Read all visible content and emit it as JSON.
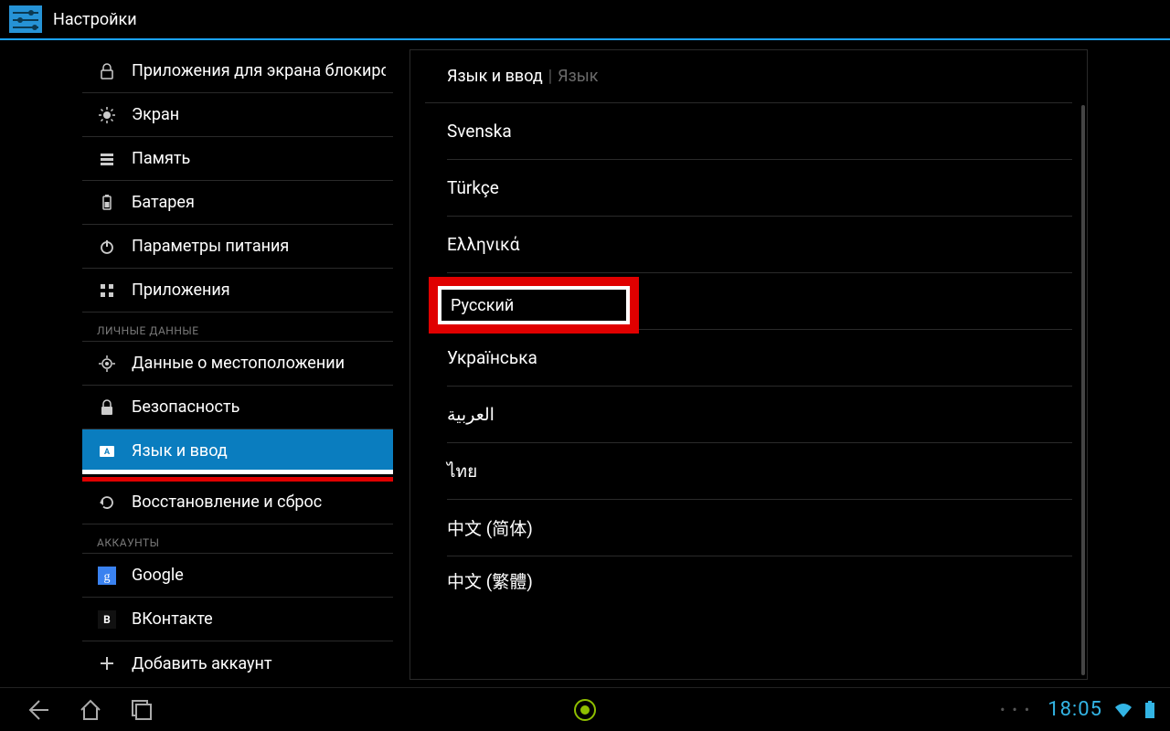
{
  "titlebar": {
    "title": "Настройки"
  },
  "sidebar": {
    "items": [
      {
        "label": "Приложения для экрана блокировки",
        "icon": "lock-icon"
      },
      {
        "label": "Экран",
        "icon": "sun-icon"
      },
      {
        "label": "Память",
        "icon": "storage-icon"
      },
      {
        "label": "Батарея",
        "icon": "battery-icon"
      },
      {
        "label": "Параметры питания",
        "icon": "power-icon"
      },
      {
        "label": "Приложения",
        "icon": "apps-icon"
      }
    ],
    "header_personal": "ЛИЧНЫЕ ДАННЫЕ",
    "personal": [
      {
        "label": "Данные о местоположении",
        "icon": "location-icon"
      },
      {
        "label": "Безопасность",
        "icon": "lock-icon"
      },
      {
        "label": "Язык и ввод",
        "icon": "keyboard-icon",
        "selected": true
      },
      {
        "label": "Восстановление и сброс",
        "icon": "restore-icon"
      }
    ],
    "header_accounts": "АККАУНТЫ",
    "accounts": [
      {
        "label": "Google",
        "icon": "google-icon"
      },
      {
        "label": "ВКонтакте",
        "icon": "vk-icon"
      },
      {
        "label": "Добавить аккаунт",
        "icon": "plus-icon"
      }
    ]
  },
  "panel": {
    "breadcrumb": {
      "main": "Язык и ввод",
      "sub": "Язык"
    },
    "languages": [
      "Svenska",
      "Türkçe",
      "Ελληνικά",
      "Русский",
      "Українська",
      "العربية",
      "ไทย",
      "中文 (简体)",
      "中文 (繁體)"
    ],
    "highlight_index": 3
  },
  "navbar": {
    "clock": "18:05"
  }
}
